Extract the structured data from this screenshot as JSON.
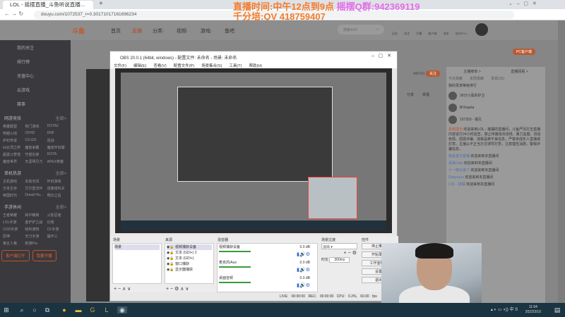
{
  "browser": {
    "tab_title": "LOL - 摇摆直播_斗鱼听说直播...",
    "url": "douyu.com/1072537_r=0.30171017161696234",
    "new_tab": "+"
  },
  "overlay": {
    "line1a": "直播时间:中午12点到9点",
    "line1b": "摇摆Q群:942369119",
    "line2": "千分培:QV  418759407"
  },
  "site": {
    "logo": "斗鱼",
    "nav": [
      "首页",
      "直播",
      "分类·",
      "视频·",
      "游戏·",
      "鱼吧"
    ],
    "search_placeholder": "搜索XXX",
    "icons": [
      "历史",
      "关注",
      "开播",
      "客户端",
      "消息",
      "成为PPU"
    ],
    "active_color": "#e0603a"
  },
  "sidebar": {
    "items": [
      "我的关注",
      "排行榜",
      "充值中心",
      "云游戏",
      "赛事"
    ],
    "sections": [
      {
        "title": "网游竞技",
        "more": "全部>",
        "games": [
          "英雄联盟",
          "热门游戏",
          "DOTA2",
          "穿越火线",
          "CFHD",
          "DNF",
          "炉石传说",
          "CS:GO",
          "逆战",
          "lol云顶之弈",
          "魔兽争霸",
          "魔兽怀旧服",
          "超激斗梦境",
          "守望先锋",
          "DOTA",
          "魔兽世界",
          "天涯明月刀",
          "APEX英雄"
        ]
      },
      {
        "title": "单机热游",
        "more": "全部>",
        "games": [
          "主机游戏",
          "永劫无间",
          "怀旧游戏",
          "方舟生存",
          "艾尔登法环",
          "逃离塔科夫",
          "帝国时代",
          "Dread Hu...",
          "明日之后"
        ]
      },
      {
        "title": "手游休闲",
        "more": "全部>",
        "games": [
          "王者荣耀",
          "和平精英",
          "火影忍者",
          "LOL手游",
          "金铲铲之战",
          "幻塔",
          "COD手游",
          "哈利波特",
          "CF手游",
          "原神",
          "天刀手游",
          "崩坏三",
          "第五人格",
          "新游Pro"
        ]
      }
    ],
    "buttons": [
      "客户端打开",
      "我要开播"
    ]
  },
  "chat": {
    "tabs": [
      "主播榜单 >",
      "直播回看 >"
    ],
    "subtabs": [
      "今日贡献",
      "本周贡献",
      "贵宾(16)"
    ],
    "rank_title": "我的贵宾等级排行",
    "ranks": [
      "30分小黑的护卫",
      "BiTequila",
      "107253 - 摇孔"
    ],
    "system_label": "系统提示:",
    "system_msg": "欢迎来到LOL - 摇摆的直播间，斗鱼严厉打击直播内容进行24小时巡查，禁止传播违法违规、暴力血腥、低俗色情、招嫖诈骗、违禁品等不良信息。严禁未成年人直播或打赏。主播以不正当方式诱导打赏，注意理性消费。警惕诈骗信息。",
    "messages": [
      {
        "user": "我是金牛座哦",
        "text": "欢迎来到本直播间"
      },
      {
        "user": "呆呆Cola",
        "text": "欢迎来到本直播间"
      },
      {
        "user": "十一郎又来了",
        "text": "欢迎来到本直播间"
      },
      {
        "user": "Douyuxxx",
        "text": "欢迎来到本直播间"
      },
      {
        "user": "LOL - 摇摆",
        "text": "欢迎来到本直播间"
      }
    ],
    "pc_client": "PC客户端",
    "follow_count": "496701",
    "follow": "关注",
    "share": "分享",
    "report": "举报"
  },
  "obs": {
    "title": "OBS 20.0.1 (64bit, windows) - 配置文件: 未命名 - 场景: 未命名",
    "menu": [
      "文件(F)",
      "编辑(E)",
      "查看(V)",
      "配置文件(P)",
      "场景集合(S)",
      "工具(T)",
      "帮助(H)"
    ],
    "docks": {
      "scenes": "场景",
      "sources": "来源",
      "mixer": "混音器",
      "transitions": "场景过渡",
      "controls": "控件"
    },
    "scene_items": [
      "场景"
    ],
    "source_items": [
      "视频捕获设备",
      "文本 (GDI+) 2",
      "文本 (GDI+)",
      "窗口捕获",
      "显示器捕获"
    ],
    "mixer_channels": [
      {
        "name": "视频捕获设备",
        "db": "0.0 dB"
      },
      {
        "name": "麦克风/Aux",
        "db": "0.0 dB"
      },
      {
        "name": "桌面音频",
        "db": "0.0 dB"
      }
    ],
    "transition": "淡出",
    "duration_label": "时长",
    "duration": "300ms",
    "controls": [
      "停止推流",
      "开始录制",
      "工作室模式",
      "设置",
      "退出"
    ],
    "status": {
      "live": "LIVE: 00:00:00",
      "rec": "REC: 00:00:00",
      "cpu": "CPU: 0.2%, 60.00 fps"
    }
  },
  "taskbar": {
    "time": "11:54",
    "date": "2022/3/10"
  }
}
